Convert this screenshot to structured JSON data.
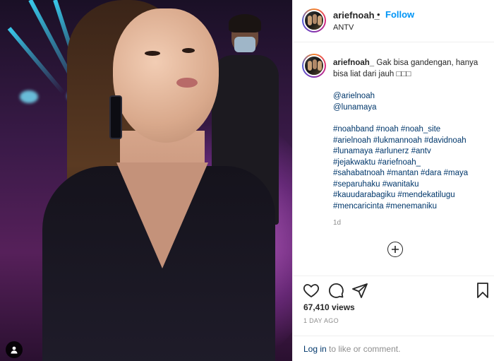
{
  "post": {
    "username": "ariefnoah_",
    "separator": "•",
    "follow_label": "Follow",
    "location": "ANTV"
  },
  "caption": {
    "username": "ariefnoah_",
    "text": "Gak bisa gandengan, hanya bisa liat dari jauh □□□",
    "mentions": [
      "@arielnoah",
      "@lunamaya"
    ],
    "hashtag_lines": [
      "#noahband #noah #noah_site",
      "#arielnoah #lukmannoah #davidnoah",
      "#lunamaya #arlunerz #antv",
      "#jejakwaktu #ariefnoah_",
      "#sahabatnoah #mantan #dara #maya",
      "#separuhaku #wanitaku",
      "#kauudarabagiku #mendekatilugu",
      "#mencaricinta #menemaniku"
    ],
    "time_ago": "1d"
  },
  "stats": {
    "views": "67,410 views",
    "date": "1 DAY AGO"
  },
  "footer": {
    "login_label": "Log in",
    "rest_text": " to like or comment."
  },
  "icons": {
    "like": "heart-icon",
    "comment": "comment-icon",
    "share": "share-icon",
    "save": "bookmark-icon",
    "user_tag": "user-tag-icon",
    "load_more": "plus-circle-icon"
  },
  "colors": {
    "follow": "#0095f6",
    "link": "#00376b",
    "muted": "#8e8e8e",
    "text": "#262626"
  }
}
